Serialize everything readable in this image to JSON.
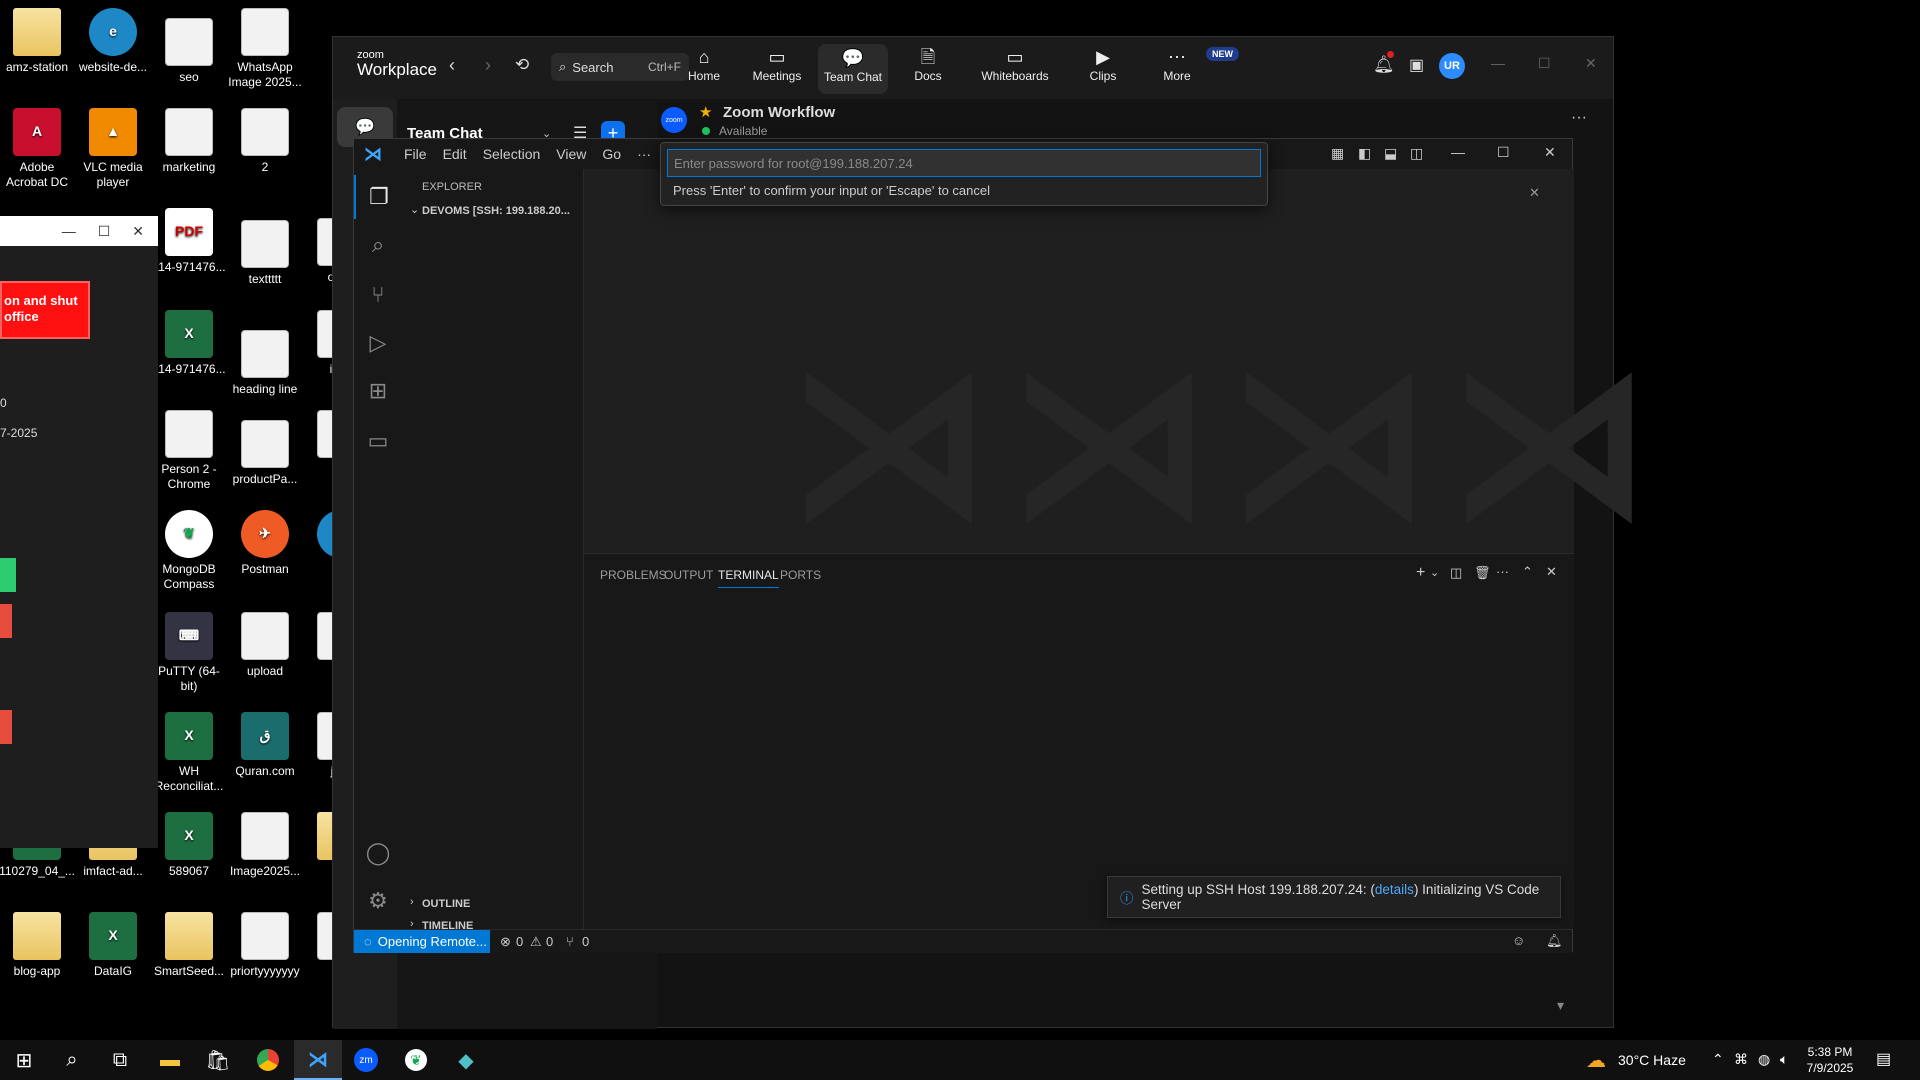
{
  "desktop": {
    "icons": [
      {
        "label": "amz-station",
        "kind": "folder"
      },
      {
        "label": "website-de...",
        "kind": "edge"
      },
      {
        "label": "seo",
        "kind": "doc"
      },
      {
        "label": "WhatsApp Image 2025...",
        "kind": "doc"
      },
      {
        "label": "Adobe Acrobat DC",
        "kind": "acrobat"
      },
      {
        "label": "VLC media player",
        "kind": "vlc"
      },
      {
        "label": "marketing",
        "kind": "doc"
      },
      {
        "label": "2",
        "kind": "doc"
      },
      {
        "label": "114-971476...",
        "kind": "pdf"
      },
      {
        "label": "texttttt",
        "kind": "doc"
      },
      {
        "label": "oned",
        "kind": "doc"
      },
      {
        "label": "114-971476...",
        "kind": "excel"
      },
      {
        "label": "heading line",
        "kind": "doc"
      },
      {
        "label": "inde",
        "kind": "doc"
      },
      {
        "label": "Person 2 - Chrome",
        "kind": "doc"
      },
      {
        "label": "productPa...",
        "kind": "doc"
      },
      {
        "label": "lan",
        "kind": "doc"
      },
      {
        "label": "MongoDB Compass",
        "kind": "mongo"
      },
      {
        "label": "Postman",
        "kind": "postman"
      },
      {
        "label": "lan",
        "kind": "edge"
      },
      {
        "label": "PuTTY (64-bit)",
        "kind": "putty"
      },
      {
        "label": "upload",
        "kind": "doc"
      },
      {
        "label": "je",
        "kind": "doc"
      },
      {
        "label": "WH Reconciliat...",
        "kind": "excel"
      },
      {
        "label": "Quran.com",
        "kind": "quran"
      },
      {
        "label": "jells",
        "kind": "doc"
      },
      {
        "label": "110279_04_...",
        "kind": "excel"
      },
      {
        "label": "imfact-ad...",
        "kind": "folder"
      },
      {
        "label": "589067",
        "kind": "excel"
      },
      {
        "label": "Image2025...",
        "kind": "doc"
      },
      {
        "label": "jell",
        "kind": "folder"
      },
      {
        "label": "blog-app",
        "kind": "folder"
      },
      {
        "label": "DataIG",
        "kind": "excel"
      },
      {
        "label": "SmartSeed...",
        "kind": "folder"
      },
      {
        "label": "priortyyyyyyy",
        "kind": "doc"
      },
      {
        "label": "log",
        "kind": "doc"
      }
    ]
  },
  "ghost_window": {
    "button_text": "on and shut office",
    "line1": "0",
    "line2": "7-2025"
  },
  "zoom": {
    "brand_line1": "zoom",
    "brand_line2": "Workplace",
    "search_label": "Search",
    "search_shortcut": "Ctrl+F",
    "nav": [
      {
        "label": "Home",
        "icon": "home-icon",
        "glyph": "⌂"
      },
      {
        "label": "Meetings",
        "icon": "video-icon",
        "glyph": "▭"
      },
      {
        "label": "Team Chat",
        "icon": "chat-icon",
        "glyph": "💬"
      },
      {
        "label": "Docs",
        "icon": "doc-icon",
        "glyph": "🗎"
      },
      {
        "label": "Whiteboards",
        "icon": "whiteboard-icon",
        "glyph": "▭"
      },
      {
        "label": "Clips",
        "icon": "clips-icon",
        "glyph": "▶"
      },
      {
        "label": "More",
        "icon": "more-icon",
        "glyph": "⋯"
      }
    ],
    "new_badge": "NEW",
    "avatar_initials": "UR",
    "panel_title": "Team Chat",
    "channel_name": "Zoom Workflow",
    "channel_status": "Available",
    "app_badge": "zoom"
  },
  "vscode": {
    "menu": [
      "File",
      "Edit",
      "Selection",
      "View",
      "Go",
      "···"
    ],
    "explorer_title": "EXPLORER",
    "workspace": "DEVOMS [SSH: 199.188.20...",
    "outline": "OUTLINE",
    "timeline": "TIMELINE",
    "panel_tabs": [
      "PROBLEMS",
      "OUTPUT",
      "TERMINAL",
      "PORTS"
    ],
    "active_panel_tab": "TERMINAL",
    "status_remote": "Opening Remote...",
    "status_errors": "0",
    "status_warnings": "0",
    "status_ports": "0",
    "quick_input": {
      "placeholder": "Enter password for root@199.188.207.24",
      "hint": "Press 'Enter' to confirm your input or 'Escape' to cancel"
    },
    "toast": {
      "prefix": "Setting up SSH Host 199.188.207.24: (",
      "link": "details",
      "suffix": ") Initializing VS Code Server"
    }
  },
  "taskbar": {
    "weather": "30°C  Haze",
    "time": "5:38 PM",
    "date": "7/9/2025"
  }
}
